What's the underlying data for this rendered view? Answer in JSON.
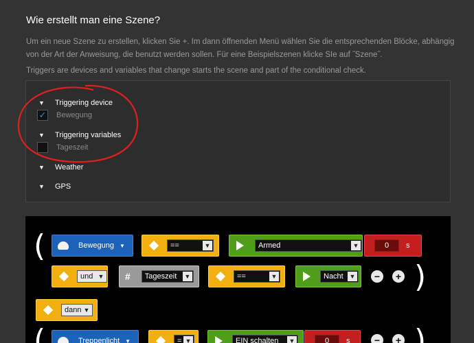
{
  "heading": "Wie erstellt man eine Szene?",
  "intro": "Um ein neue Szene zu erstellen, klicken Sie +. Im dann öffnenden Menü wählen Sie die entsprechenden Blöcke, abhängig von der Art der Anweisung, die benutzt werden sollen. Für eine Beispielszenen klicke SIe auf ˝Szene˝.",
  "triggers_note": "Triggers are devices and variables that change starts the scene and part of the conditional check.",
  "triggers": [
    {
      "label": "Triggering device",
      "item": "Bewegung",
      "checked": true
    },
    {
      "label": "Triggering variables",
      "item": "Tageszeit",
      "checked": false
    },
    {
      "label": "Weather"
    },
    {
      "label": "GPS"
    }
  ],
  "scene": {
    "row1": {
      "device": "Bewegung",
      "operator": "==",
      "value": "Armed",
      "delay": "0",
      "unit": "s"
    },
    "row2": {
      "logic": "und",
      "variable": "Tageszeit",
      "operator": "==",
      "value": "Nacht"
    },
    "row3": {
      "then": "dann"
    },
    "row4": {
      "device": "Treppenlicht",
      "operator": "=",
      "action": "EIN schalten",
      "delay": "0",
      "unit": "s"
    },
    "paren_open": "(",
    "paren_close": ")",
    "minus": "−",
    "plus": "+"
  },
  "icons": {
    "chevron": "chevron-down-icon",
    "check": "check-icon",
    "device": "device-icon",
    "play": "play-icon",
    "diamond": "diamond-icon",
    "hash": "hash-icon"
  },
  "colors": {
    "blue": "#1b62b8",
    "yellow": "#f2b010",
    "green": "#4f9e1a",
    "red": "#c41f1f",
    "annotation": "#e02020"
  }
}
